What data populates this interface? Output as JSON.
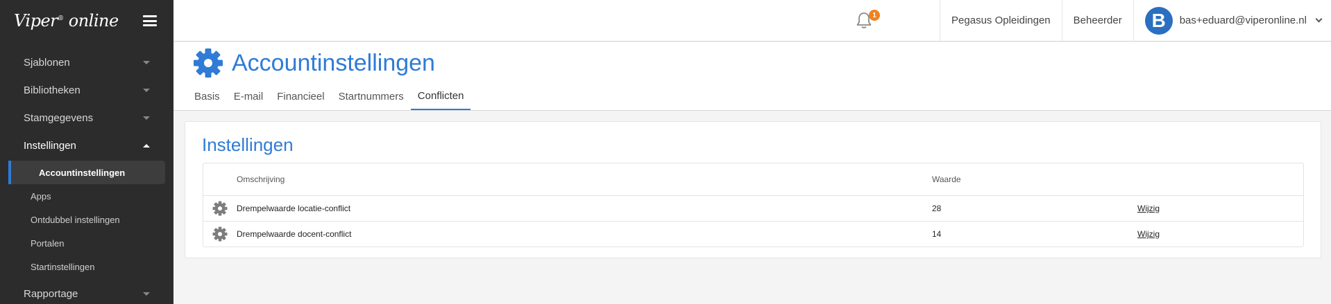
{
  "app": {
    "logo_text": "Viper",
    "logo_reg": "®",
    "logo_text2": "online"
  },
  "sidebar": {
    "items": [
      {
        "label": "Sjablonen"
      },
      {
        "label": "Bibliotheken"
      },
      {
        "label": "Stamgegevens"
      },
      {
        "label": "Instellingen"
      }
    ],
    "sub_items": [
      {
        "label": "Accountinstellingen"
      },
      {
        "label": "Apps"
      },
      {
        "label": "Ontdubbel instellingen"
      },
      {
        "label": "Portalen"
      },
      {
        "label": "Startinstellingen"
      }
    ],
    "last_item": {
      "label": "Rapportage"
    }
  },
  "topbar": {
    "notifications_count": "1",
    "organisation": "Pegasus Opleidingen",
    "role": "Beheerder",
    "user_initial": "B",
    "user_email": "bas+eduard@viperonline.nl"
  },
  "page": {
    "title": "Accountinstellingen",
    "tabs": [
      {
        "label": "Basis"
      },
      {
        "label": "E-mail"
      },
      {
        "label": "Financieel"
      },
      {
        "label": "Startnummers"
      },
      {
        "label": "Conflicten"
      }
    ]
  },
  "panel": {
    "title": "Instellingen",
    "columns": {
      "description": "Omschrijving",
      "value": "Waarde"
    },
    "rows": [
      {
        "description": "Drempelwaarde locatie-conflict",
        "value": "28",
        "action": "Wijzig"
      },
      {
        "description": "Drempelwaarde docent-conflict",
        "value": "14",
        "action": "Wijzig"
      }
    ]
  },
  "colors": {
    "accent": "#2f7bd6",
    "sidebar_bg": "#2c2c2c",
    "badge": "#f0821e",
    "avatar": "#2a6fc0"
  },
  "icons": [
    "hamburger-icon",
    "bell-icon",
    "gear-icon",
    "chevron-down-icon"
  ]
}
